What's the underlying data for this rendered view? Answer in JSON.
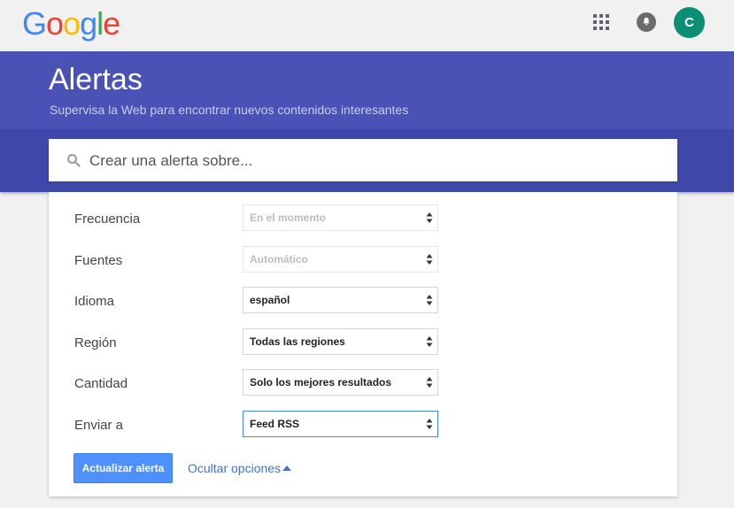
{
  "brand": {
    "letters": [
      "G",
      "o",
      "o",
      "g",
      "l",
      "e"
    ],
    "colors": [
      "#4285f4",
      "#ea4335",
      "#fbbc05",
      "#4285f4",
      "#34a853",
      "#ea4335"
    ]
  },
  "topbar": {
    "apps_icon": "grid-apps-icon",
    "notifications_icon": "bell-icon",
    "avatar_initial": "C",
    "avatar_color": "#0a8f75"
  },
  "header": {
    "title": "Alertas",
    "subtitle": "Supervisa la Web para encontrar nuevos contenidos interesantes",
    "band_color": "#4a52b5"
  },
  "search": {
    "placeholder": "Crear una alerta sobre...",
    "value": ""
  },
  "options": [
    {
      "label": "Frecuencia",
      "value": "En el momento",
      "disabled": true
    },
    {
      "label": "Fuentes",
      "value": "Automático",
      "disabled": true
    },
    {
      "label": "Idioma",
      "value": "español",
      "disabled": false
    },
    {
      "label": "Región",
      "value": "Todas las regiones",
      "disabled": false
    },
    {
      "label": "Cantidad",
      "value": "Solo los mejores resultados",
      "disabled": false
    },
    {
      "label": "Enviar a",
      "value": "Feed RSS",
      "disabled": false,
      "focused": true
    }
  ],
  "actions": {
    "update_label": "Actualizar alerta",
    "hide_label": "Ocultar opciones",
    "accent": "#4d90fe"
  }
}
